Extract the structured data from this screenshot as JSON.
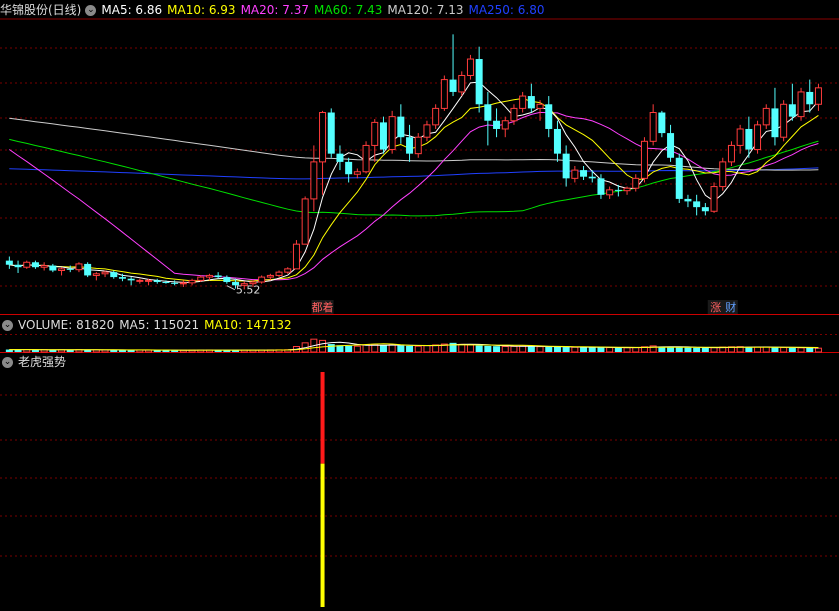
{
  "main_legend": {
    "stock_name": "华锦股份(日线)",
    "ma5": "MA5: 6.86",
    "ma10": "MA10: 6.93",
    "ma20": "MA20: 7.37",
    "ma60": "MA60: 7.43",
    "ma120": "MA120: 7.13",
    "ma250": "MA250: 6.80"
  },
  "volume_legend": {
    "label": "VOLUME: 81820",
    "ma5": "MA5: 115021",
    "ma10": "MA10: 147132"
  },
  "indicator_legend": {
    "label": "老虎强势"
  },
  "colors": {
    "up": "#ff3c3c",
    "down": "#54ffff",
    "ma5": "#ffffff",
    "ma10": "#ffff00",
    "ma20": "#ff40ff",
    "ma60": "#00e000",
    "ma120": "#cccccc",
    "ma250": "#2040ff",
    "grid": "#7a0000",
    "text": "#dddddd"
  },
  "chart_data": [
    {
      "type": "candlestick",
      "y_range": [
        5.2,
        8.7
      ],
      "candles": [
        [
          5.8,
          5.85,
          5.7,
          5.75
        ],
        [
          5.75,
          5.8,
          5.65,
          5.72
        ],
        [
          5.72,
          5.8,
          5.7,
          5.78
        ],
        [
          5.78,
          5.8,
          5.7,
          5.72
        ],
        [
          5.72,
          5.78,
          5.68,
          5.74
        ],
        [
          5.74,
          5.76,
          5.66,
          5.68
        ],
        [
          5.68,
          5.72,
          5.62,
          5.7
        ],
        [
          5.7,
          5.74,
          5.66,
          5.69
        ],
        [
          5.69,
          5.78,
          5.66,
          5.76
        ],
        [
          5.76,
          5.78,
          5.6,
          5.62
        ],
        [
          5.62,
          5.66,
          5.56,
          5.64
        ],
        [
          5.64,
          5.68,
          5.6,
          5.66
        ],
        [
          5.66,
          5.68,
          5.58,
          5.6
        ],
        [
          5.6,
          5.64,
          5.55,
          5.58
        ],
        [
          5.58,
          5.6,
          5.5,
          5.56
        ],
        [
          5.56,
          5.58,
          5.52,
          5.56
        ],
        [
          5.56,
          5.58,
          5.5,
          5.56
        ],
        [
          5.56,
          5.58,
          5.52,
          5.54
        ],
        [
          5.54,
          5.56,
          5.52,
          5.53
        ],
        [
          5.53,
          5.56,
          5.5,
          5.52
        ],
        [
          5.52,
          5.56,
          5.48,
          5.53
        ],
        [
          5.53,
          5.58,
          5.5,
          5.56
        ],
        [
          5.56,
          5.62,
          5.54,
          5.6
        ],
        [
          5.6,
          5.64,
          5.56,
          5.62
        ],
        [
          5.62,
          5.66,
          5.58,
          5.6
        ],
        [
          5.6,
          5.62,
          5.52,
          5.54
        ],
        [
          5.54,
          5.58,
          5.46,
          5.5
        ],
        [
          5.5,
          5.55,
          5.45,
          5.52
        ],
        [
          5.52,
          5.56,
          5.48,
          5.54
        ],
        [
          5.54,
          5.62,
          5.52,
          5.6
        ],
        [
          5.6,
          5.64,
          5.56,
          5.62
        ],
        [
          5.62,
          5.68,
          5.6,
          5.66
        ],
        [
          5.66,
          5.72,
          5.64,
          5.7
        ],
        [
          5.7,
          6.05,
          5.7,
          6.0
        ],
        [
          6.0,
          6.58,
          6.0,
          6.55
        ],
        [
          6.55,
          7.2,
          6.4,
          7.0
        ],
        [
          7.0,
          7.62,
          6.6,
          7.6
        ],
        [
          7.6,
          7.65,
          7.05,
          7.1
        ],
        [
          7.1,
          7.2,
          6.9,
          7.0
        ],
        [
          7.0,
          7.05,
          6.75,
          6.85
        ],
        [
          6.85,
          6.92,
          6.8,
          6.88
        ],
        [
          6.88,
          7.25,
          6.86,
          7.2
        ],
        [
          7.2,
          7.52,
          7.0,
          7.48
        ],
        [
          7.48,
          7.55,
          7.1,
          7.15
        ],
        [
          7.15,
          7.62,
          7.1,
          7.55
        ],
        [
          7.55,
          7.7,
          7.22,
          7.3
        ],
        [
          7.3,
          7.45,
          7.0,
          7.1
        ],
        [
          7.1,
          7.35,
          7.05,
          7.3
        ],
        [
          7.3,
          7.5,
          7.25,
          7.45
        ],
        [
          7.45,
          7.7,
          7.4,
          7.65
        ],
        [
          7.65,
          8.05,
          7.62,
          8.0
        ],
        [
          8.0,
          8.55,
          7.8,
          7.85
        ],
        [
          7.85,
          8.1,
          7.8,
          8.05
        ],
        [
          8.05,
          8.3,
          8.0,
          8.25
        ],
        [
          8.25,
          8.4,
          7.6,
          7.7
        ],
        [
          7.7,
          7.85,
          7.2,
          7.5
        ],
        [
          7.5,
          7.65,
          7.3,
          7.4
        ],
        [
          7.4,
          7.55,
          7.3,
          7.5
        ],
        [
          7.5,
          7.7,
          7.45,
          7.65
        ],
        [
          7.65,
          7.85,
          7.6,
          7.8
        ],
        [
          7.8,
          7.95,
          7.6,
          7.65
        ],
        [
          7.65,
          7.75,
          7.5,
          7.7
        ],
        [
          7.7,
          7.8,
          7.3,
          7.4
        ],
        [
          7.4,
          7.5,
          7.0,
          7.1
        ],
        [
          7.1,
          7.2,
          6.7,
          6.8
        ],
        [
          6.8,
          6.95,
          6.75,
          6.9
        ],
        [
          6.9,
          6.95,
          6.78,
          6.82
        ],
        [
          6.82,
          6.9,
          6.75,
          6.8
        ],
        [
          6.8,
          6.85,
          6.55,
          6.6
        ],
        [
          6.6,
          6.7,
          6.55,
          6.66
        ],
        [
          6.66,
          6.72,
          6.58,
          6.65
        ],
        [
          6.65,
          6.7,
          6.6,
          6.68
        ],
        [
          6.68,
          6.85,
          6.64,
          6.8
        ],
        [
          6.8,
          7.3,
          6.75,
          7.25
        ],
        [
          7.25,
          7.7,
          7.2,
          7.6
        ],
        [
          7.6,
          7.62,
          7.3,
          7.35
        ],
        [
          7.35,
          7.45,
          7.0,
          7.05
        ],
        [
          7.05,
          7.1,
          6.5,
          6.55
        ],
        [
          6.55,
          6.6,
          6.45,
          6.52
        ],
        [
          6.52,
          6.6,
          6.35,
          6.45
        ],
        [
          6.45,
          6.5,
          6.35,
          6.4
        ],
        [
          6.4,
          6.75,
          6.38,
          6.7
        ],
        [
          6.7,
          7.05,
          6.65,
          7.0
        ],
        [
          7.0,
          7.25,
          6.95,
          7.2
        ],
        [
          7.2,
          7.45,
          7.1,
          7.4
        ],
        [
          7.4,
          7.55,
          7.05,
          7.15
        ],
        [
          7.15,
          7.5,
          7.1,
          7.45
        ],
        [
          7.45,
          7.7,
          7.4,
          7.65
        ],
        [
          7.65,
          7.9,
          7.2,
          7.3
        ],
        [
          7.3,
          7.75,
          7.25,
          7.7
        ],
        [
          7.7,
          7.95,
          7.5,
          7.55
        ],
        [
          7.55,
          7.9,
          7.5,
          7.85
        ],
        [
          7.85,
          8.0,
          7.6,
          7.7
        ],
        [
          7.7,
          7.95,
          7.62,
          7.9
        ]
      ],
      "annotations": [
        {
          "text": "5.52",
          "index": 25
        }
      ],
      "signals": [
        {
          "text": "都着",
          "index": 36
        },
        {
          "text": "涨 财",
          "index": 82
        }
      ]
    },
    {
      "type": "bar",
      "name": "VOLUME",
      "scale_max": 720000,
      "values": [
        80000,
        78000,
        76000,
        74000,
        75000,
        72000,
        70000,
        72000,
        74000,
        70000,
        68000,
        66000,
        68000,
        65000,
        64000,
        66000,
        62000,
        60000,
        58000,
        60000,
        59000,
        62000,
        64000,
        66000,
        64000,
        62000,
        60000,
        62000,
        63000,
        65000,
        68000,
        70000,
        74000,
        180000,
        300000,
        420000,
        380000,
        260000,
        220000,
        200000,
        190000,
        230000,
        250000,
        220000,
        240000,
        210000,
        200000,
        190000,
        210000,
        230000,
        260000,
        300000,
        250000,
        230000,
        210000,
        200000,
        190000,
        180000,
        185000,
        190000,
        180000,
        175000,
        170000,
        165000,
        160000,
        155000,
        150000,
        150000,
        148000,
        145000,
        143000,
        140000,
        145000,
        170000,
        200000,
        180000,
        160000,
        150000,
        145000,
        140000,
        138000,
        142000,
        160000,
        170000,
        175000,
        150000,
        160000,
        165000,
        150000,
        145000,
        140000,
        135000,
        130000,
        125000
      ]
    },
    {
      "type": "bar",
      "name": "老虎强势",
      "signal_index": 36,
      "segments": [
        {
          "from": 0,
          "to": 0.39,
          "color": "#ff1a1a"
        },
        {
          "from": 0.39,
          "to": 1,
          "color": "#ffff00"
        }
      ]
    }
  ]
}
